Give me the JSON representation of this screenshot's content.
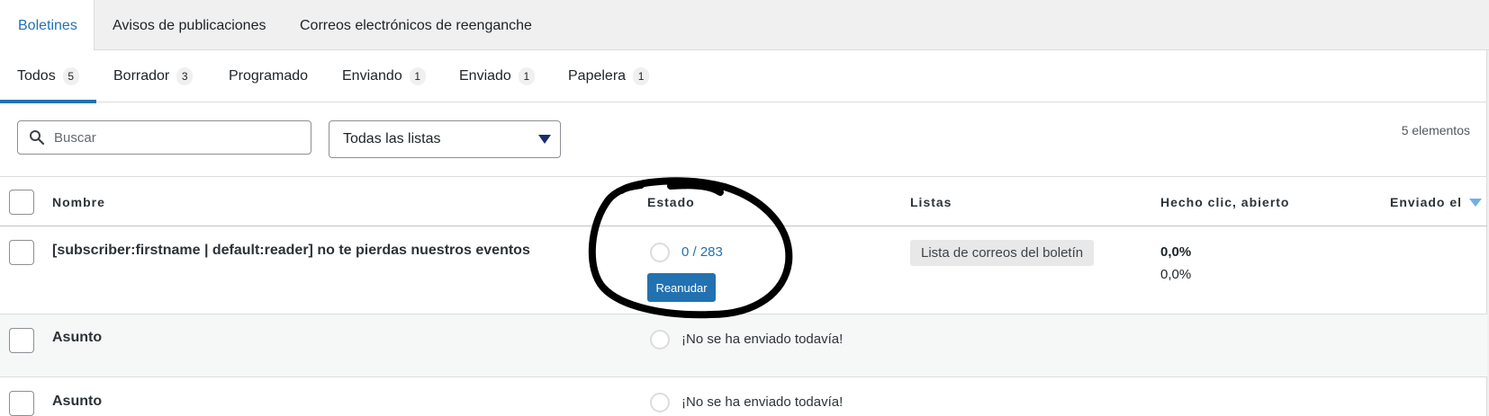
{
  "top_tabs": [
    {
      "label": "Boletines"
    },
    {
      "label": "Avisos de publicaciones"
    },
    {
      "label": "Correos electrónicos de reenganche"
    }
  ],
  "sub_tabs": [
    {
      "label": "Todos",
      "count": "5"
    },
    {
      "label": "Borrador",
      "count": "3"
    },
    {
      "label": "Programado",
      "count": ""
    },
    {
      "label": "Enviando",
      "count": "1"
    },
    {
      "label": "Enviado",
      "count": "1"
    },
    {
      "label": "Papelera",
      "count": "1"
    }
  ],
  "filters": {
    "search_placeholder": "Buscar",
    "list_select": "Todas las listas",
    "items_count": "5 elementos"
  },
  "table": {
    "columns": [
      "Nombre",
      "Estado",
      "Listas",
      "Hecho clic, abierto",
      "Enviado el"
    ],
    "rows": [
      {
        "name": "[subscriber:firstname | default:reader] no te pierdas nuestros eventos",
        "progress": "0 / 283",
        "action": "Reanudar",
        "list": "Lista de correos del boletín",
        "clicked": "0,0%",
        "opened": "0,0%"
      },
      {
        "name": "Asunto",
        "status": "¡No se ha enviado todavía!"
      },
      {
        "name": "Asunto",
        "status": "¡No se ha enviado todavía!"
      }
    ]
  },
  "colors": {
    "accent": "#2271b1",
    "annotation": "#000000"
  }
}
